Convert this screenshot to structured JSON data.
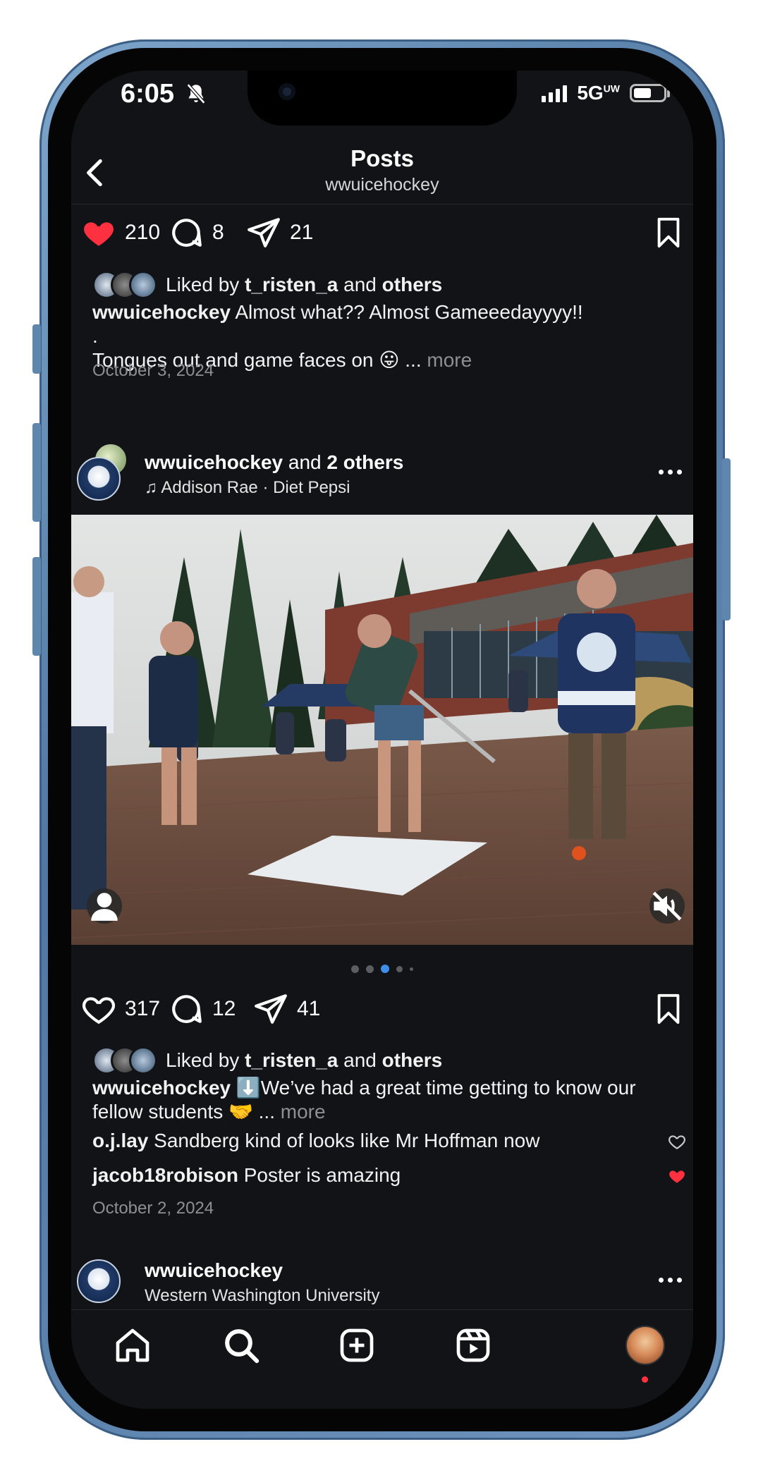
{
  "status_bar": {
    "time": "6:05",
    "network": "5G",
    "network_sup": "UW"
  },
  "header": {
    "title": "Posts",
    "subtitle": "wwuicehockey"
  },
  "post1": {
    "likes": "210",
    "comments": "8",
    "shares": "21",
    "liked_by_prefix": "Liked by",
    "liked_by_user": "t_risten_a",
    "liked_by_and": "and",
    "liked_by_others": "others",
    "caption_user": "wwuicehockey",
    "caption_text": "Almost what?? Almost Gameeedayyyy!!",
    "caption_dot": ".",
    "caption_line2": "Tongues out and game faces on 😛",
    "caption_ellipsis": "...",
    "more_label": "more",
    "date": "October 3, 2024"
  },
  "post2": {
    "header_user": "wwuicehockey",
    "header_and": "and",
    "header_others": "2 others",
    "music_label": "Addison Rae · Diet Pepsi",
    "likes": "317",
    "comments": "12",
    "shares": "41",
    "liked_by_prefix": "Liked by",
    "liked_by_user": "t_risten_a",
    "liked_by_and": "and",
    "liked_by_others": "others",
    "caption_user": "wwuicehockey",
    "caption_text": "⬇️We’ve had a great time getting to know our fellow students 🤝",
    "caption_ellipsis": "...",
    "more_label": "more",
    "comments_list": [
      {
        "user": "o.j.lay",
        "text": "Sandberg kind of looks like Mr Hoffman now",
        "liked": false
      },
      {
        "user": "jacob18robison",
        "text": "Poster is amazing",
        "liked": true
      }
    ],
    "date": "October 2, 2024",
    "carousel": {
      "count": 5,
      "active": 3
    }
  },
  "post3": {
    "header_user": "wwuicehockey",
    "location": "Western Washington University"
  },
  "bottom_nav": [
    "home-icon",
    "search-icon",
    "create-icon",
    "reels-icon",
    "profile-avatar"
  ],
  "colors": {
    "like_red": "#ff3040",
    "background": "#121316",
    "carousel_active": "#3f8ee8",
    "phone_frame": "#5f86ad"
  }
}
